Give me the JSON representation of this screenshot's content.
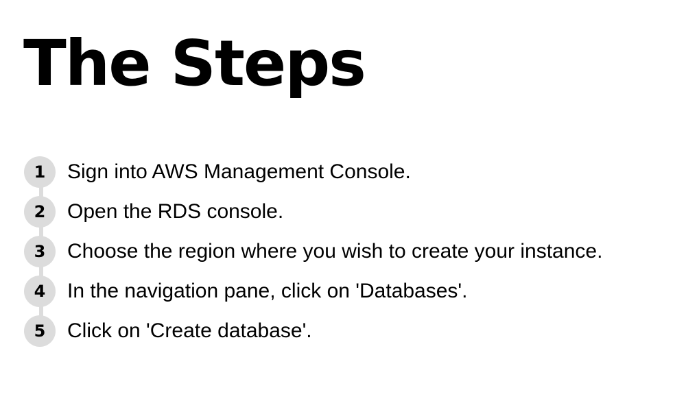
{
  "slide": {
    "title": "The Steps",
    "steps": [
      {
        "number": "1",
        "text": "Sign into AWS Management Console."
      },
      {
        "number": "2",
        "text": "Open the RDS console."
      },
      {
        "number": "3",
        "text": "Choose the region where you wish to create your instance."
      },
      {
        "number": "4",
        "text": "In the navigation pane, click on 'Databases'."
      },
      {
        "number": "5",
        "text": "Click on 'Create database'."
      }
    ]
  },
  "colors": {
    "text": "#000000",
    "badge": "#dcdcdc",
    "background": "#ffffff"
  }
}
